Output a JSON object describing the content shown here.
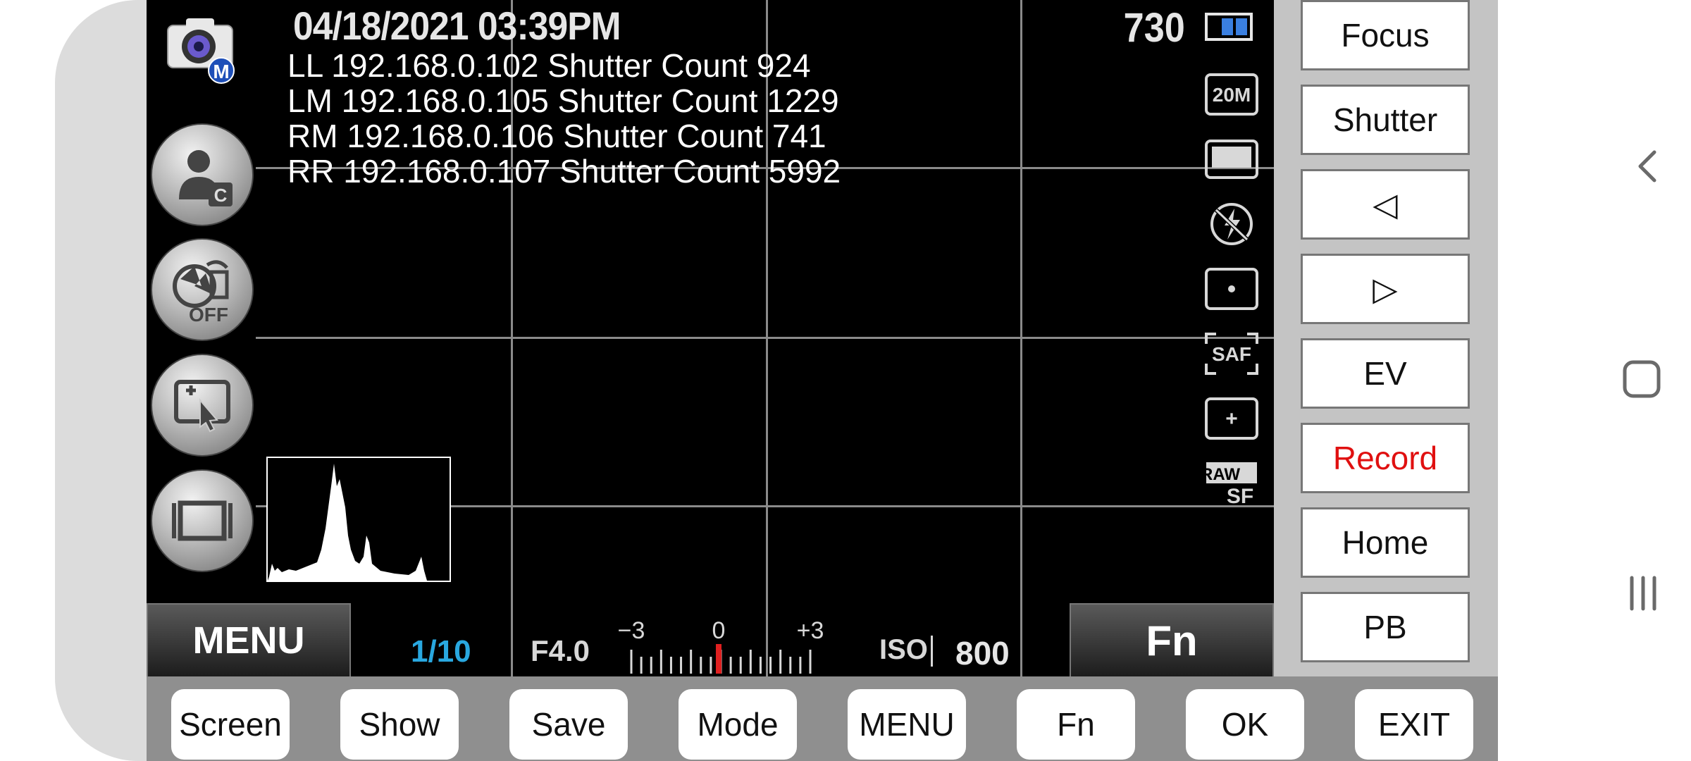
{
  "status": {
    "datetime": "04/18/2021 03:39PM",
    "shots_remaining": "730",
    "mode_badge": "M"
  },
  "info_lines": [
    "LL 192.168.0.102 Shutter Count 924",
    "LM 192.168.0.105 Shutter Count 1229",
    "RM 192.168.0.106 Shutter Count 741",
    "RR 192.168.0.107 Shutter Count 5992"
  ],
  "status_icons": {
    "image_size": "20M",
    "af_mode": "SAF",
    "raw_top": "RAW",
    "raw_bottom": "SF",
    "af_point": "+"
  },
  "left_buttons": {
    "custom_badge": "C",
    "off_badge": "OFF"
  },
  "exposure": {
    "shutter_speed": "1/10",
    "aperture": "F4.0",
    "ev_min": "−3",
    "ev_zero": "0",
    "ev_max": "+3",
    "iso_label": "ISO",
    "iso_value": "800"
  },
  "screen_buttons": {
    "menu": "MENU",
    "fn": "Fn"
  },
  "side_buttons": [
    {
      "label": "Focus"
    },
    {
      "label": "Shutter"
    },
    {
      "label": "◁"
    },
    {
      "label": "▷"
    },
    {
      "label": "EV"
    },
    {
      "label": "Record"
    },
    {
      "label": "Home"
    },
    {
      "label": "PB"
    }
  ],
  "bottom_buttons": [
    {
      "label": "Screen"
    },
    {
      "label": "Show"
    },
    {
      "label": "Save"
    },
    {
      "label": "Mode"
    },
    {
      "label": "MENU"
    },
    {
      "label": "Fn"
    },
    {
      "label": "OK"
    },
    {
      "label": "EXIT"
    }
  ],
  "colors": {
    "record_text": "#e01010",
    "shutter_speed": "#29a8e0",
    "ev_indicator": "#e02020"
  }
}
